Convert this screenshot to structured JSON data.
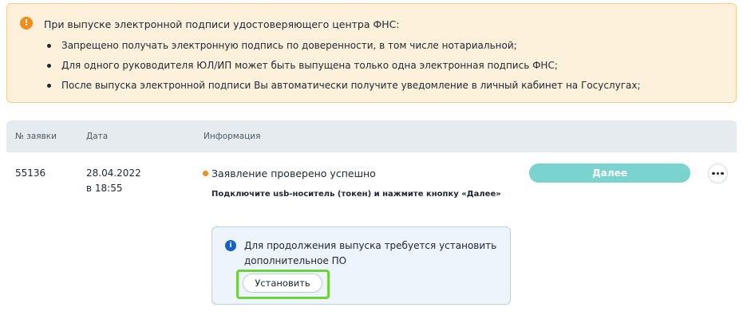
{
  "notice": {
    "icon": "warning-icon",
    "icon_glyph": "!",
    "title": "При выпуске электронной подписи удостоверяющего центра ФНС:",
    "items": [
      "Запрещено получать электронную подпись по доверенности, в том числе нотариальной;",
      "Для одного руководителя ЮЛ/ИП может быть выпущена только одна электронная подпись ФНС;",
      "После выпуска электронной подписи Вы автоматически получите уведомление в личный кабинет на Госуслугах;"
    ]
  },
  "table": {
    "headers": [
      "№ заявки",
      "Дата",
      "Информация"
    ],
    "row": {
      "number": "55136",
      "date": "28.04.2022",
      "time": "в 18:55",
      "status": "Заявление проверено успешно",
      "status_color": "#f28c1d",
      "hint": "Подключите usb-носитель (токен) и нажмите кнопку «Далее»",
      "next_label": "Далее",
      "more_icon": "more-horizontal-icon"
    }
  },
  "info": {
    "icon": "info-icon",
    "icon_glyph": "i",
    "text": "Для продолжения выпуска требуется установить дополнительное ПО",
    "install_label": "Установить"
  },
  "colors": {
    "accent_teal": "#7ad3cf",
    "warning_bg": "#fdf1db",
    "info_bg": "#eef4fc",
    "highlight": "#6cd33a"
  }
}
